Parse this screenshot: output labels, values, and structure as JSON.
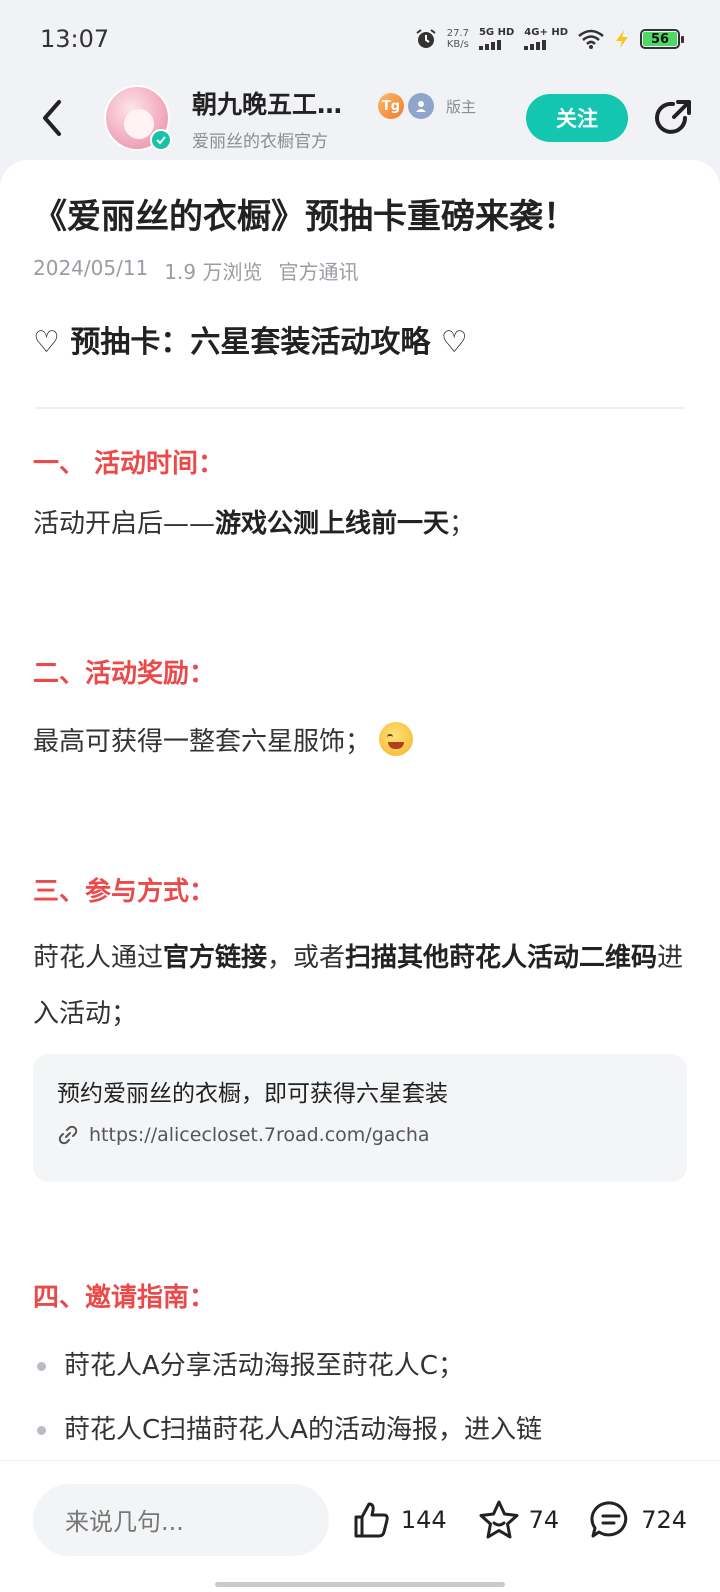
{
  "status_bar": {
    "time": "13:07",
    "net_speed_value": "27.7",
    "net_speed_unit": "KB/s",
    "sim1": "5G HD",
    "sim2": "4G+ HD",
    "battery": "56"
  },
  "header": {
    "author_name": "朝九晚五工…",
    "author_sub": "爱丽丝的衣橱官方",
    "badge_tg": "Tg",
    "role": "版主",
    "follow_label": "关注"
  },
  "post": {
    "title": "《爱丽丝的衣橱》预抽卡重磅来袭！",
    "date": "2024/05/11",
    "views": "1.9 万浏览",
    "category": "官方通讯",
    "subtitle": "♡ 预抽卡：六星套装活动攻略 ♡",
    "sections": [
      {
        "heading": "一、 活动时间：",
        "text_a": "活动开启后——",
        "bold_a": "游戏公测上线前一天",
        "text_b": "；"
      },
      {
        "heading": "二、活动奖励：",
        "text_a": "最高可获得一整套六星服饰；"
      },
      {
        "heading": "三、参与方式：",
        "text_a": "莳花人通过",
        "bold_a": "官方链接",
        "text_b": "，或者",
        "bold_b": "扫描其他莳花人活动二维码",
        "text_c": "进入活动；"
      },
      {
        "heading": "四、邀请指南：",
        "bullets": [
          "莳花人A分享活动海报至莳花人C；",
          "莳花人C扫描莳花人A的活动海报，进入链"
        ]
      }
    ],
    "link_card": {
      "title": "预约爱丽丝的衣橱，即可获得六星套装",
      "url": "https://alicecloset.7road.com/gacha"
    }
  },
  "bottom_bar": {
    "comment_placeholder": "来说几句...",
    "likes": "144",
    "favorites": "74",
    "comments": "724"
  },
  "colors": {
    "accent": "#14c5b0",
    "section_heading": "#ec4a4a"
  }
}
